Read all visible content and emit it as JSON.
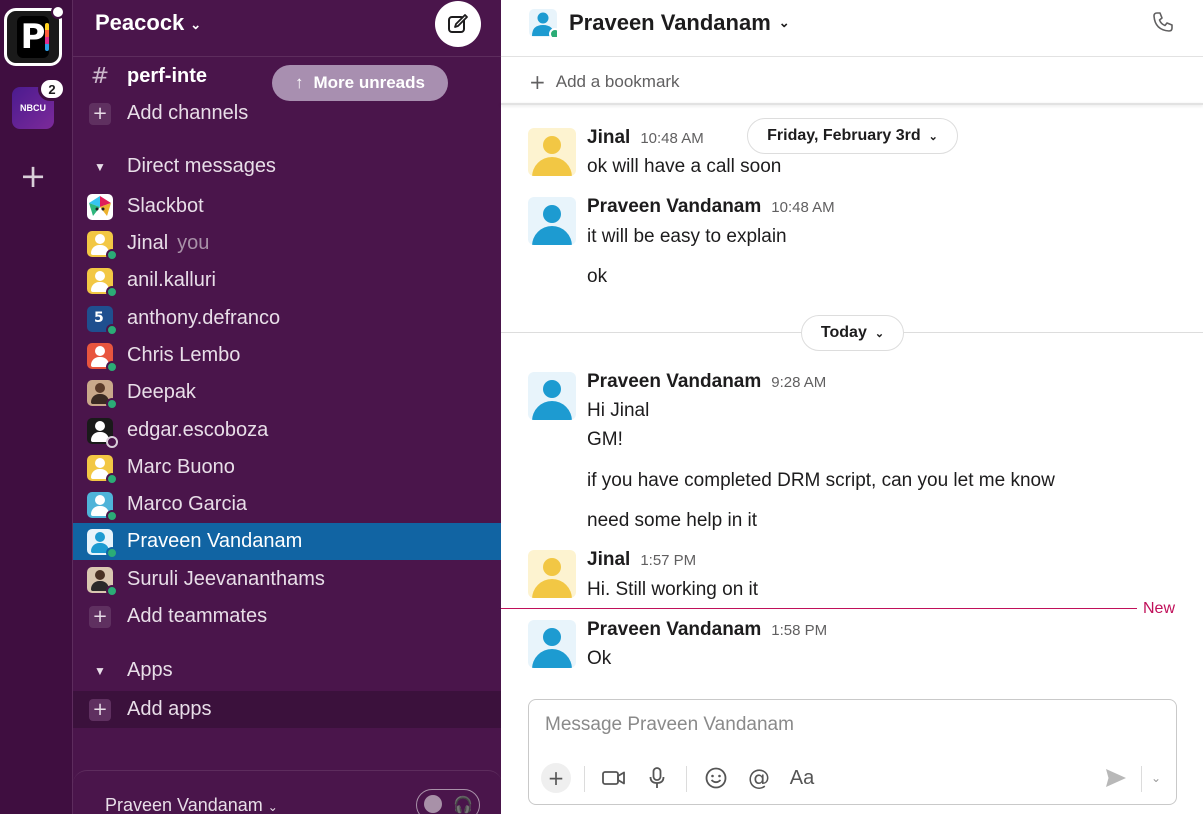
{
  "workspace_rail": {
    "primary_workspace": "P",
    "secondary_workspace": "NBCU",
    "secondary_badge": "2",
    "add_icon": "plus-icon"
  },
  "sidebar": {
    "workspace_name": "Peacock",
    "compose_icon": "compose-icon",
    "more_unreads": "More unreads",
    "channel_partial": "perf-inte",
    "add_channels": "Add channels",
    "direct_messages_header": "Direct messages",
    "dms": [
      {
        "name": "Slackbot",
        "suffix": ""
      },
      {
        "name": "Jinal",
        "suffix": "you"
      },
      {
        "name": "anil.kalluri",
        "suffix": ""
      },
      {
        "name": "anthony.defranco",
        "suffix": ""
      },
      {
        "name": "Chris Lembo",
        "suffix": ""
      },
      {
        "name": "Deepak",
        "suffix": ""
      },
      {
        "name": "edgar.escoboza",
        "suffix": ""
      },
      {
        "name": "Marc Buono",
        "suffix": ""
      },
      {
        "name": "Marco Garcia",
        "suffix": ""
      },
      {
        "name": "Praveen Vandanam",
        "suffix": ""
      },
      {
        "name": "Suruli Jeevananthams",
        "suffix": ""
      }
    ],
    "add_teammates": "Add teammates",
    "apps_header": "Apps",
    "add_apps": "Add apps",
    "footer_name": "Praveen Vandanam"
  },
  "channel": {
    "title": "Praveen Vandanam",
    "add_bookmark": "Add a bookmark",
    "call_icon": "phone-icon"
  },
  "dividers": {
    "first_day": "Friday, February 3rd",
    "today": "Today",
    "new_label": "New"
  },
  "messages": [
    {
      "author": "Jinal",
      "time": "10:48 AM",
      "lines": [
        "ok will have a call soon"
      ]
    },
    {
      "author": "Praveen Vandanam",
      "time": "10:48 AM",
      "lines": [
        "it will be easy to explain",
        "ok"
      ]
    },
    {
      "author": "Praveen Vandanam",
      "time": "9:28 AM",
      "lines": [
        "Hi Jinal",
        "GM!",
        "if you have completed DRM script, can you let me know",
        "need some help in it"
      ]
    },
    {
      "author": "Jinal",
      "time": "1:57 PM",
      "lines": [
        "Hi. Still working on it"
      ]
    },
    {
      "author": "Praveen Vandanam",
      "time": "1:58 PM",
      "lines": [
        "Ok"
      ]
    }
  ],
  "composer": {
    "placeholder": "Message Praveen Vandanam",
    "format_label": "Aa"
  }
}
